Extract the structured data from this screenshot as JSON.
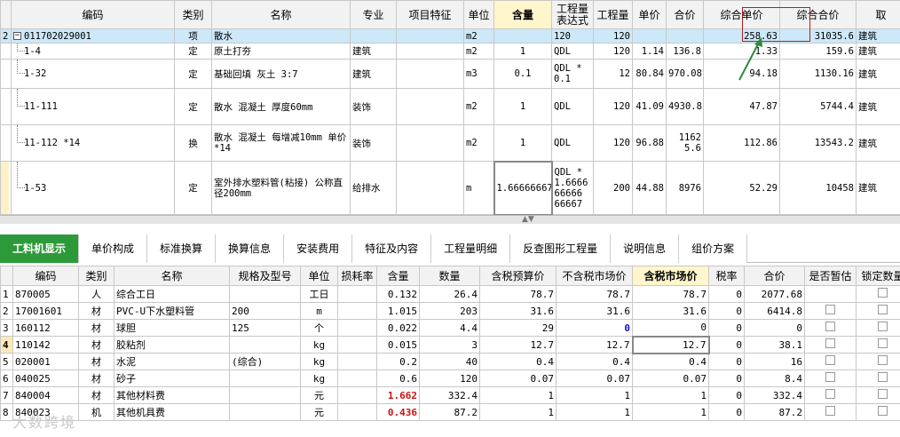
{
  "top_headers": [
    "编码",
    "类别",
    "名称",
    "专业",
    "项目特征",
    "单位",
    "含量",
    "工程量表达式",
    "工程量",
    "单价",
    "合价",
    "综合单价",
    "综合合价",
    "取"
  ],
  "top_rows": [
    {
      "num": "2",
      "code": "011702029001",
      "type": "项",
      "name": "散水",
      "spec": "",
      "feature": "",
      "unit": "m2",
      "qty": "",
      "expr": "120",
      "amount": "120",
      "price": "",
      "total": "",
      "comp_price": "258.63",
      "comp_total": "31035.6",
      "fee": "建筑"
    },
    {
      "num": "",
      "code": "1-4",
      "type": "定",
      "name": "原土打夯",
      "spec": "建筑",
      "feature": "",
      "unit": "m2",
      "qty": "1",
      "expr": "QDL",
      "amount": "120",
      "price": "1.14",
      "total": "136.8",
      "comp_price": "1.33",
      "comp_total": "159.6",
      "fee": "建筑"
    },
    {
      "num": "",
      "code": "1-32",
      "type": "定",
      "name": "基础回填 灰土 3:7",
      "spec": "建筑",
      "feature": "",
      "unit": "m3",
      "qty": "0.1",
      "expr": "QDL *0.1",
      "amount": "12",
      "price": "80.84",
      "total": "970.08",
      "comp_price": "94.18",
      "comp_total": "1130.16",
      "fee": "建筑"
    },
    {
      "num": "",
      "code": "11-111",
      "type": "定",
      "name": "散水 混凝土 厚度60mm",
      "spec": "装饰",
      "feature": "",
      "unit": "m2",
      "qty": "1",
      "expr": "QDL",
      "amount": "120",
      "price": "41.09",
      "total": "4930.8",
      "comp_price": "47.87",
      "comp_total": "5744.4",
      "fee": "建筑"
    },
    {
      "num": "",
      "code": "11-112 *14",
      "type": "换",
      "name": "散水 混凝土 每增减10mm 单价 *14",
      "spec": "装饰",
      "feature": "",
      "unit": "m2",
      "qty": "1",
      "expr": "QDL",
      "amount": "120",
      "price": "96.88",
      "total": "11625.6",
      "comp_price": "112.86",
      "comp_total": "13543.2",
      "fee": "建筑"
    },
    {
      "num": "",
      "code": "1-53",
      "type": "定",
      "name": "室外排水塑料管(粘接) 公称直径200mm",
      "spec": "给排水",
      "feature": "",
      "unit": "m",
      "qty": "1.66666667",
      "expr": "QDL *1.666666666 66667",
      "amount": "200",
      "price": "44.88",
      "total": "8976",
      "comp_price": "52.29",
      "comp_total": "10458",
      "fee": "建筑"
    }
  ],
  "tabs": [
    "工料机显示",
    "单价构成",
    "标准换算",
    "换算信息",
    "安装费用",
    "特征及内容",
    "工程量明细",
    "反查图形工程量",
    "说明信息",
    "组价方案"
  ],
  "bottom_headers": [
    "编码",
    "类别",
    "名称",
    "规格及型号",
    "单位",
    "损耗率",
    "含量",
    "数量",
    "含税预算价",
    "不含税市场价",
    "含税市场价",
    "税率",
    "合价",
    "是否暂估",
    "锁定数量"
  ],
  "bottom_rows": [
    {
      "n": "1",
      "code": "870005",
      "type": "人",
      "name": "综合工日",
      "spec": "",
      "unit": "工日",
      "loss": "",
      "qty": "0.132",
      "amount": "26.4",
      "budget": "78.7",
      "market_notax": "78.7",
      "market_tax": "78.7",
      "tax": "0",
      "total": "2077.68"
    },
    {
      "n": "2",
      "code": "17001601",
      "type": "材",
      "name": "PVC-U下水塑料管",
      "spec": "200",
      "unit": "m",
      "loss": "",
      "qty": "1.015",
      "amount": "203",
      "budget": "31.6",
      "market_notax": "31.6",
      "market_tax": "31.6",
      "tax": "0",
      "total": "6414.8"
    },
    {
      "n": "3",
      "code": "160112",
      "type": "材",
      "name": "球胆",
      "spec": "125",
      "unit": "个",
      "loss": "",
      "qty": "0.022",
      "amount": "4.4",
      "budget": "29",
      "market_notax": "0",
      "market_tax": "0",
      "tax": "0",
      "total": "0"
    },
    {
      "n": "4",
      "code": "110142",
      "type": "材",
      "name": "胶粘剂",
      "spec": "",
      "unit": "kg",
      "loss": "",
      "qty": "0.015",
      "amount": "3",
      "budget": "12.7",
      "market_notax": "12.7",
      "market_tax": "12.7",
      "tax": "0",
      "total": "38.1"
    },
    {
      "n": "5",
      "code": "020001",
      "type": "材",
      "name": "水泥",
      "spec": "(综合)",
      "unit": "kg",
      "loss": "",
      "qty": "0.2",
      "amount": "40",
      "budget": "0.4",
      "market_notax": "0.4",
      "market_tax": "0.4",
      "tax": "0",
      "total": "16"
    },
    {
      "n": "6",
      "code": "040025",
      "type": "材",
      "name": "砂子",
      "spec": "",
      "unit": "kg",
      "loss": "",
      "qty": "0.6",
      "amount": "120",
      "budget": "0.07",
      "market_notax": "0.07",
      "market_tax": "0.07",
      "tax": "0",
      "total": "8.4"
    },
    {
      "n": "7",
      "code": "840004",
      "type": "材",
      "name": "其他材料费",
      "spec": "",
      "unit": "元",
      "loss": "",
      "qty": "1.662",
      "amount": "332.4",
      "budget": "1",
      "market_notax": "1",
      "market_tax": "1",
      "tax": "0",
      "total": "332.4"
    },
    {
      "n": "8",
      "code": "840023",
      "type": "机",
      "name": "其他机具费",
      "spec": "",
      "unit": "元",
      "loss": "",
      "qty": "0.436",
      "amount": "87.2",
      "budget": "1",
      "market_notax": "1",
      "market_tax": "1",
      "tax": "0",
      "total": "87.2"
    }
  ],
  "watermark": "大数跨境"
}
